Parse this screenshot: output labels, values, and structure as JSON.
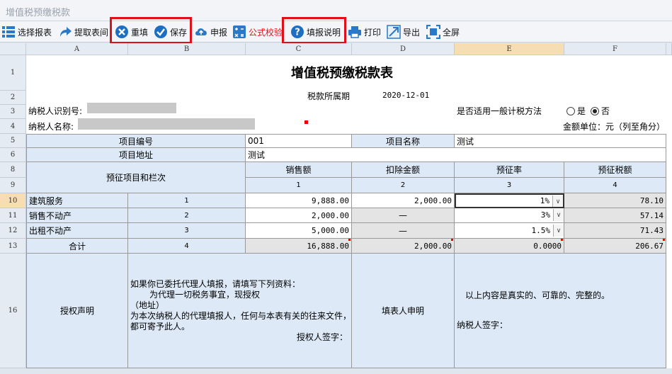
{
  "window": {
    "title": "增值税预缴税款"
  },
  "toolbar": {
    "select_form": "选择报表",
    "fetch_form": "提取表间",
    "refill": "重填",
    "save": "保存",
    "declare": "申报",
    "formula_check": "公式校验",
    "fill_guide": "填报说明",
    "print": "打印",
    "export": "导出",
    "fullscreen": "全屏"
  },
  "columns": [
    "A",
    "B",
    "C",
    "D",
    "E",
    "F"
  ],
  "rows": [
    "1",
    "2",
    "3",
    "4",
    "5",
    "6",
    "8",
    "9",
    "10",
    "11",
    "12",
    "13",
    "16"
  ],
  "form": {
    "title": "增值税预缴税款表",
    "period_label": "税款所属期",
    "period_value": "2020-12-01",
    "taxpayer_id_label": "纳税人识别号:",
    "taxpayer_name_label": "纳税人名称:",
    "general_method_label": "是否适用一般计税方法",
    "yes_label": "是",
    "no_label": "否",
    "general_method_selected": "否",
    "unit_label": "金额单位：元（列至角分）",
    "project_no_label": "项目编号",
    "project_no_value": "001",
    "project_name_label": "项目名称",
    "project_name_value": "测试",
    "project_address_label": "项目地址",
    "project_address_value": "测试",
    "item_header": "预征项目和栏次",
    "col_sales": "销售额",
    "col_deduct": "扣除金额",
    "col_rate": "预征率",
    "col_tax": "预征税额",
    "col_no_1": "1",
    "col_no_2": "2",
    "col_no_3": "3",
    "col_no_4": "4",
    "items": [
      {
        "name": "建筑服务",
        "no": "1",
        "sales": "9,888.00",
        "deduct": "2,000.00",
        "rate": "1%",
        "tax": "78.10"
      },
      {
        "name": "销售不动产",
        "no": "2",
        "sales": "2,000.00",
        "deduct": "—",
        "rate": "3%",
        "tax": "57.14"
      },
      {
        "name": "出租不动产",
        "no": "3",
        "sales": "5,000.00",
        "deduct": "—",
        "rate": "1.5%",
        "tax": "71.43"
      }
    ],
    "total": {
      "name": "合计",
      "no": "4",
      "sales": "16,888.00",
      "deduct": "2,000.00",
      "rate": "0.0000",
      "tax": "206.67"
    },
    "auth_label": "授权声明",
    "auth_line1": "如果你已委托代理人填报，请填写下列资料：",
    "auth_line2": "为代理一切税务事宜，现授权",
    "auth_line3": "（地址）",
    "auth_line4": "为本次纳税人的代理填报人，任何与本表有关的往来文件，",
    "auth_line5": "都可寄予此人。",
    "auth_sign": "授权人签字：",
    "filer_label": "填表人申明",
    "filer_statement": "以上内容是真实的、可靠的、完整的。",
    "filer_sign": "纳税人签字："
  }
}
